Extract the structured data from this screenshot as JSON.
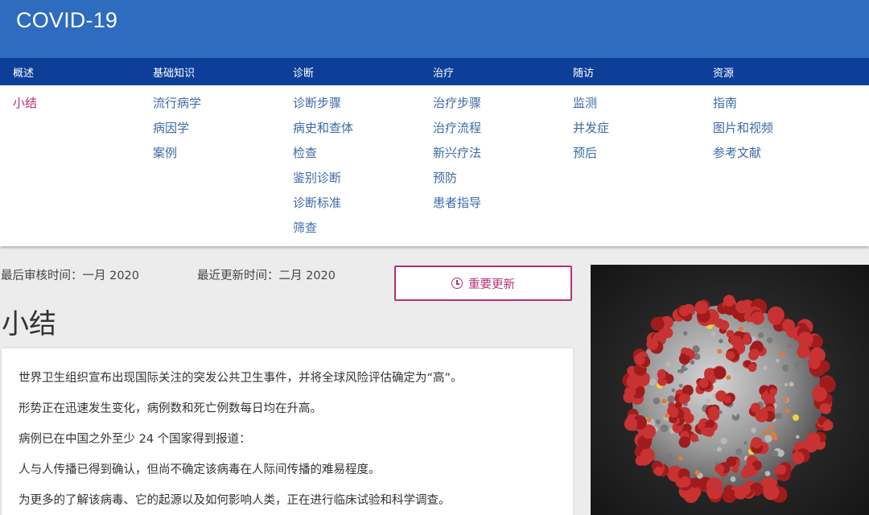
{
  "app": {
    "title": "COVID-19"
  },
  "nav": {
    "categories": [
      {
        "label": "概述",
        "links": [
          "小结"
        ]
      },
      {
        "label": "基础知识",
        "links": [
          "流行病学",
          "病因学",
          "案例"
        ]
      },
      {
        "label": "诊断",
        "links": [
          "诊断步骤",
          "病史和查体",
          "检查",
          "鉴别诊断",
          "诊断标准",
          "筛查"
        ]
      },
      {
        "label": "治疗",
        "links": [
          "治疗步骤",
          "治疗流程",
          "新兴疗法",
          "预防",
          "患者指导"
        ]
      },
      {
        "label": "随访",
        "links": [
          "监测",
          "并发症",
          "预后"
        ]
      },
      {
        "label": "资源",
        "links": [
          "指南",
          "图片和视频",
          "参考文献"
        ]
      }
    ],
    "active_link": "小结"
  },
  "meta": {
    "last_reviewed": "最后审核时间：一月 2020",
    "last_updated": "最近更新时间：二月  2020"
  },
  "update_button": {
    "label": "重要更新",
    "icon": "history-clock-icon"
  },
  "page": {
    "title": "小结",
    "paragraphs": [
      "世界卫生组织宣布出现国际关注的突发公共卫生事件，并将全球风险评估确定为“高”。",
      "形势正在迅速发生变化，病例数和死亡例数每日均在升高。",
      "病例已在中国之外至少 24 个国家得到报道：",
      "人与人传播已得到确认，但尚不确定该病毒在人际间传播的难易程度。",
      "为更多的了解该病毒、它的起源以及如何影响人类，正在进行临床试验和科学调查。"
    ]
  },
  "image": {
    "subject": "coronavirus-illustration"
  },
  "colors": {
    "header_blue": "#2d6cbf",
    "nav_dark_blue": "#0d3f99",
    "link_blue": "#3b6aa8",
    "accent_magenta": "#b2307a",
    "background": "#ececec"
  }
}
